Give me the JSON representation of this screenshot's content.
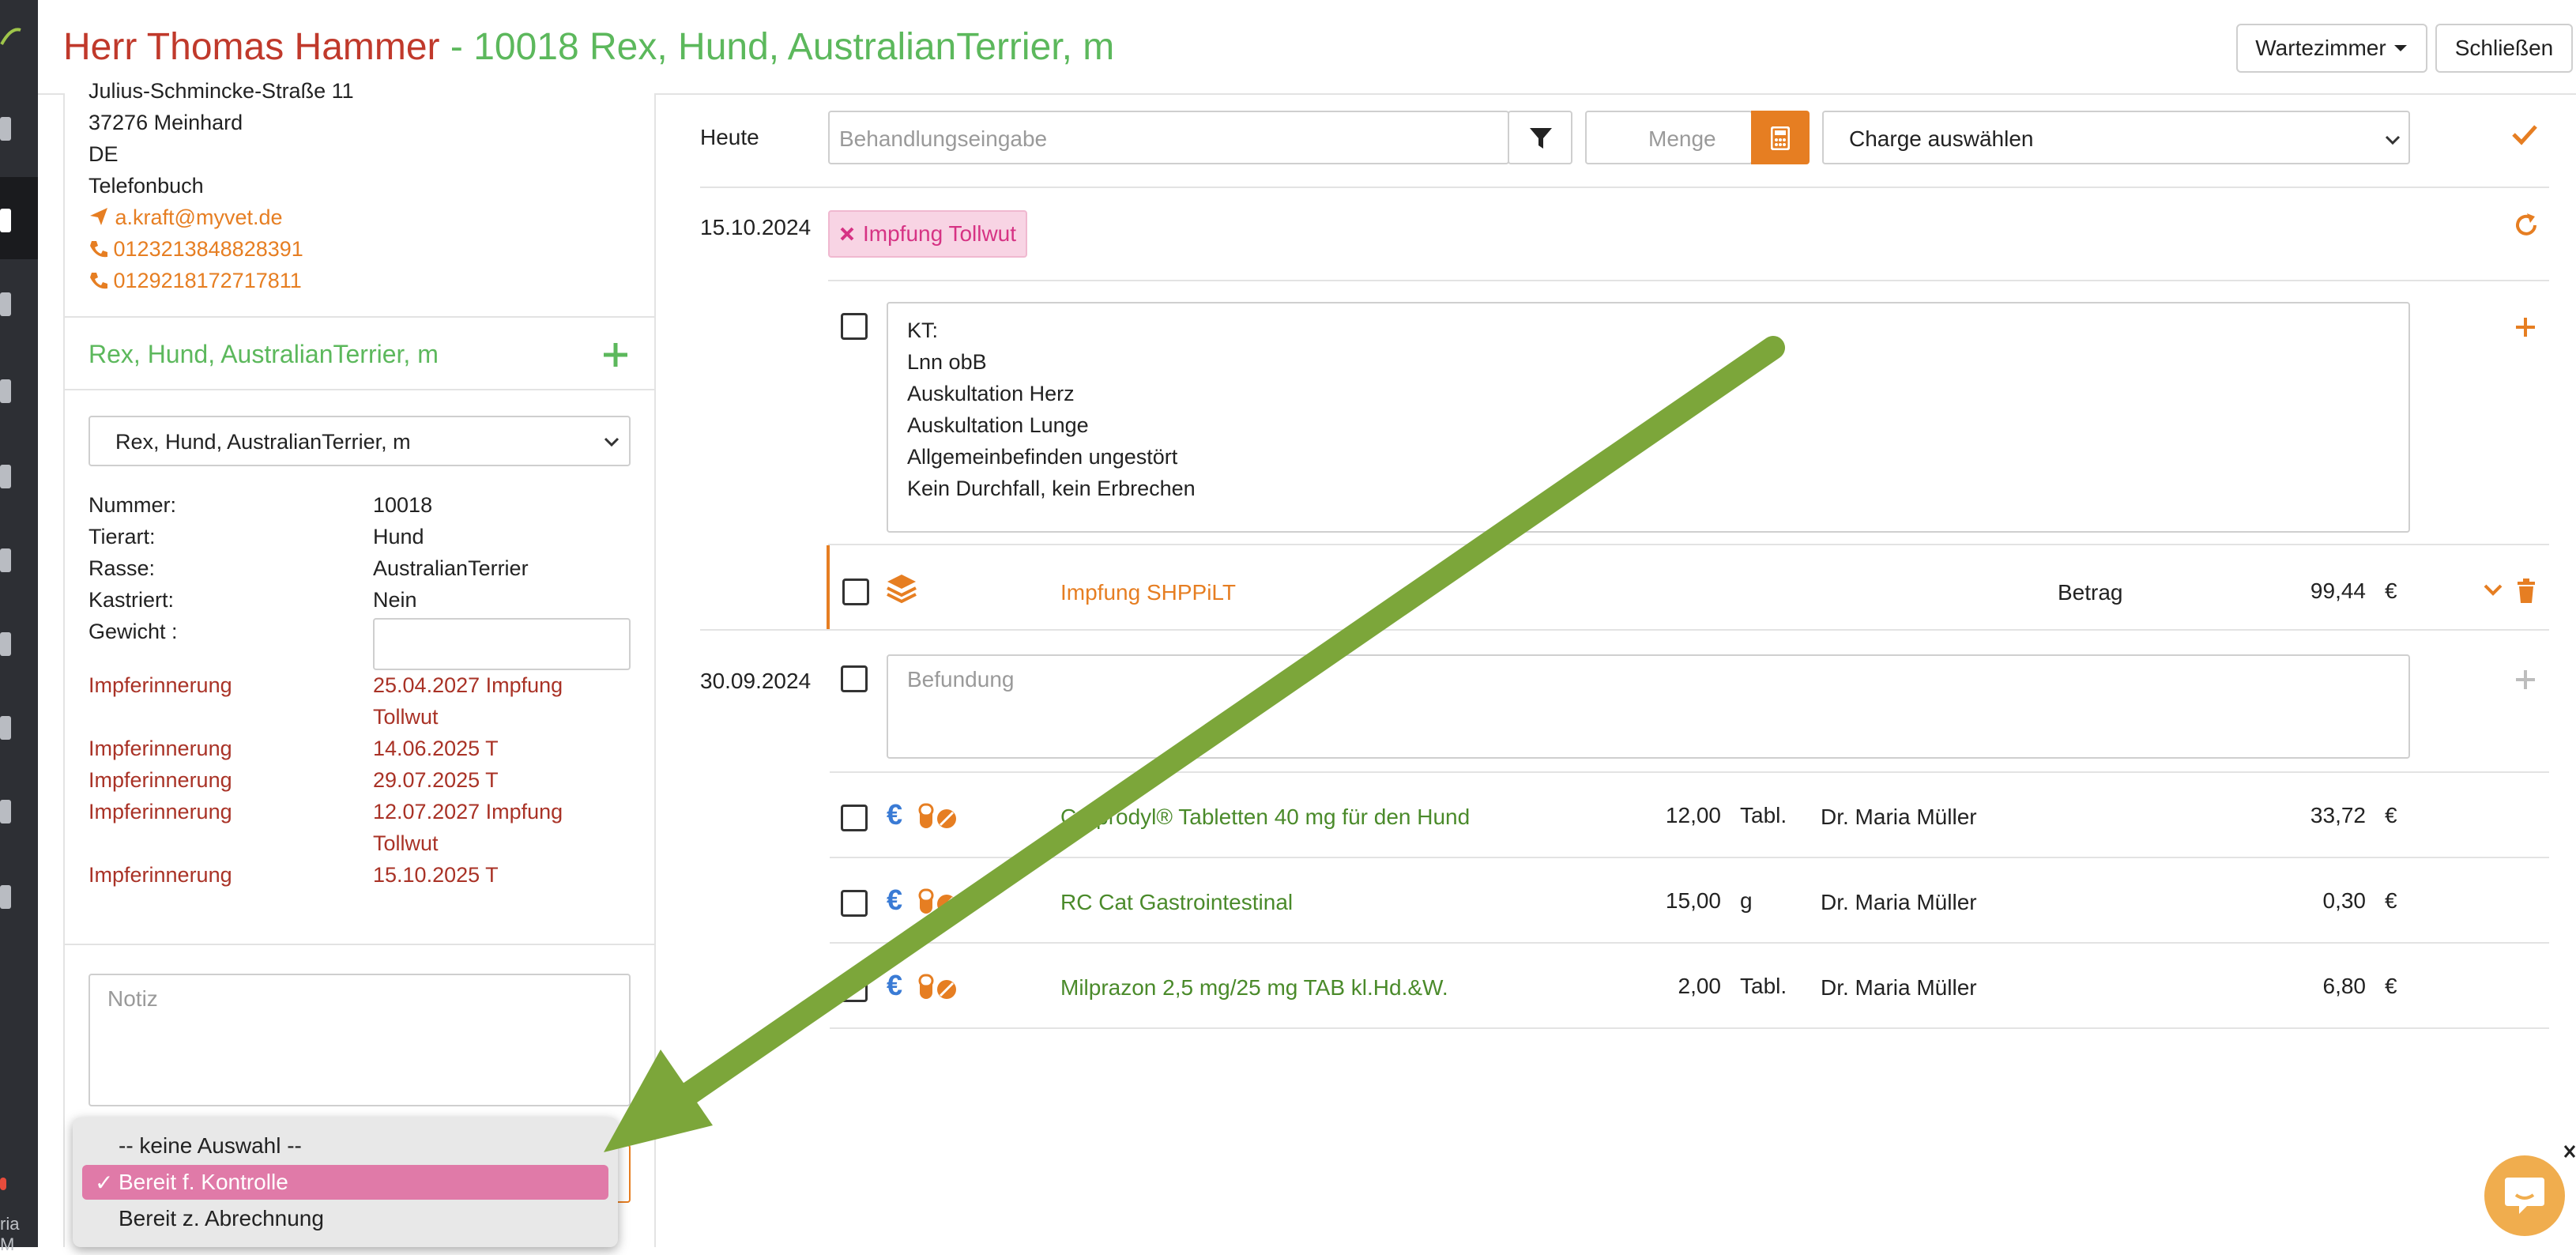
{
  "header": {
    "owner": "Herr Thomas Hammer",
    "patient": " - 10018 Rex, Hund, AustralianTerrier, m",
    "waiting_room_label": "Wartezimmer",
    "close_label": "Schließen"
  },
  "rail": {
    "user_partial": "ria M"
  },
  "owner_info": {
    "street": "Julius-Schmincke-Straße 11",
    "city": "37276  Meinhard",
    "country": "DE",
    "phonebook": "Telefonbuch",
    "email": "a.kraft@myvet.de",
    "phone1": "0123213848828391",
    "phone2": "0129218172717811"
  },
  "animal": {
    "heading": "Rex, Hund, AustralianTerrier, m",
    "select_value": "Rex, Hund, AustralianTerrier, m",
    "fields": [
      {
        "label": "Nummer:",
        "value": "10018"
      },
      {
        "label": "Tierart:",
        "value": "Hund"
      },
      {
        "label": "Rasse:",
        "value": "AustralianTerrier"
      },
      {
        "label": "Kastriert:",
        "value": "Nein"
      },
      {
        "label": "Gewicht :",
        "value": ""
      }
    ],
    "reminders": [
      {
        "label": "Impferinnerung",
        "value": "25.04.2027 Impfung",
        "value2": "Tollwut"
      },
      {
        "label": "Impferinnerung",
        "value": "14.06.2025 T",
        "value2": ""
      },
      {
        "label": "Impferinnerung",
        "value": "29.07.2025 T",
        "value2": ""
      },
      {
        "label": "Impferinnerung",
        "value": "12.07.2027 Impfung",
        "value2": "Tollwut"
      },
      {
        "label": "Impferinnerung",
        "value": "15.10.2025 T",
        "value2": ""
      }
    ],
    "note_placeholder": "Notiz"
  },
  "status_dropdown": {
    "options": [
      "-- keine Auswahl --",
      "Bereit f. Kontrolle",
      "Bereit z. Abrechnung"
    ],
    "selected": "Bereit f. Kontrolle",
    "check": "✓"
  },
  "entry": {
    "today_label": "Heute",
    "treatment_placeholder": "Behandlungseingabe",
    "quantity_placeholder": "Menge",
    "batch_placeholder": "Charge auswählen"
  },
  "visits": [
    {
      "date": "15.10.2024",
      "tag": "Impfung Tollwut",
      "findings": [
        "KT:",
        "Lnn obB",
        "Auskultation Herz",
        "Auskultation Lunge",
        "Allgemeinbefinden ungestört",
        "Kein Durchfall, kein Erbrechen"
      ],
      "service": {
        "name": "Impfung SHPPiLT",
        "label": "Betrag",
        "amount": "99,44",
        "currency": "€"
      }
    },
    {
      "date": "30.09.2024",
      "findings_placeholder": "Befundung",
      "items": [
        {
          "name": "Carprodyl® Tabletten 40 mg für den Hund",
          "qty": "12,00",
          "unit": "Tabl.",
          "doctor": "Dr. Maria Müller",
          "price": "33,72",
          "currency": "€"
        },
        {
          "name": "RC Cat Gastrointestinal",
          "qty": "15,00",
          "unit": "g",
          "doctor": "Dr. Maria Müller",
          "price": "0,30",
          "currency": "€"
        },
        {
          "name": "Milprazon 2,5 mg/25 mg TAB kl.Hd.&W.",
          "qty": "2,00",
          "unit": "Tabl.",
          "doctor": "Dr. Maria Müller",
          "price": "6,80",
          "currency": "€"
        }
      ]
    }
  ],
  "colors": {
    "owner_red": "#c0392b",
    "patient_green": "#5cb85c",
    "accent_orange": "#e67e22",
    "arrow_green": "#7ca63a",
    "highlight_pink": "#e07aa8"
  },
  "icons": [
    "filter-icon",
    "calculator-icon",
    "check-icon",
    "refresh-icon",
    "plus-icon",
    "layers-icon",
    "chevron-down-icon",
    "trash-icon",
    "euro-icon",
    "pill-icon",
    "chat-icon",
    "send-icon",
    "phone-icon",
    "close-x-icon"
  ]
}
